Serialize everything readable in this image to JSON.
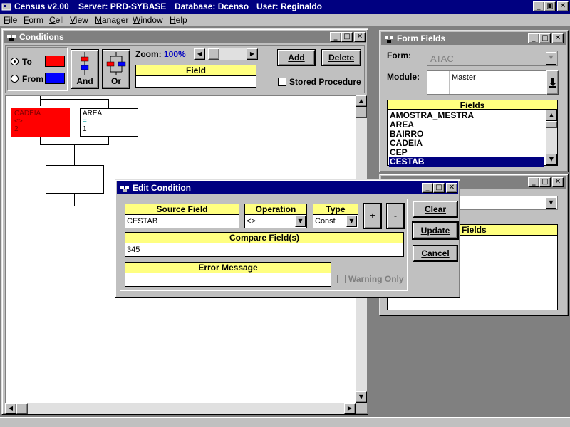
{
  "app": {
    "title": "Census v2.00",
    "server": "Server: PRD-SYBASE",
    "database": "Database: Dcenso",
    "user": "User: Reginaldo"
  },
  "menu": [
    "File",
    "Form",
    "Cell",
    "View",
    "Manager",
    "Window",
    "Help"
  ],
  "conditions": {
    "title": "Conditions",
    "to_label": "To",
    "from_label": "From",
    "to_color": "#ff0000",
    "from_color": "#0000ff",
    "and_label": "And",
    "or_label": "Or",
    "zoom_label": "Zoom:",
    "zoom_value": "100%",
    "field_header": "Field",
    "field_value": "",
    "add_label": "Add",
    "delete_label": "Delete",
    "stored_procedure_label": "Stored Procedure",
    "stored_procedure_checked": false,
    "nodes": [
      {
        "line1": "CADEIA",
        "line2": "<>",
        "line3": "2",
        "color": "#ff0000"
      },
      {
        "line1": "AREA",
        "line2": "=",
        "line3": "1",
        "color": "#ffffff"
      }
    ]
  },
  "form_fields": {
    "title": "Form Fields",
    "form_label": "Form:",
    "form_value": "ATAC",
    "module_label": "Module:",
    "module_value": "Master",
    "fields_header": "Fields",
    "fields": [
      "AMOSTRA_MESTRA",
      "AREA",
      "BAIRRO",
      "CADEIA",
      "CEP",
      "CESTAB"
    ],
    "selected_field": "CESTAB"
  },
  "edit_condition": {
    "title": "Edit Condition",
    "source_field_header": "Source Field",
    "source_field_value": "CESTAB",
    "operation_header": "Operation",
    "operation_value": "<>",
    "type_header": "Type",
    "type_value": "Const",
    "plus_label": "+",
    "minus_label": "-",
    "compare_header": "Compare Field(s)",
    "compare_value": "345",
    "error_header": "Error Message",
    "error_value": "",
    "warning_label": "Warning Only",
    "clear_label": "Clear",
    "update_label": "Update",
    "cancel_label": "Cancel",
    "back_fields_header": "Fields"
  }
}
